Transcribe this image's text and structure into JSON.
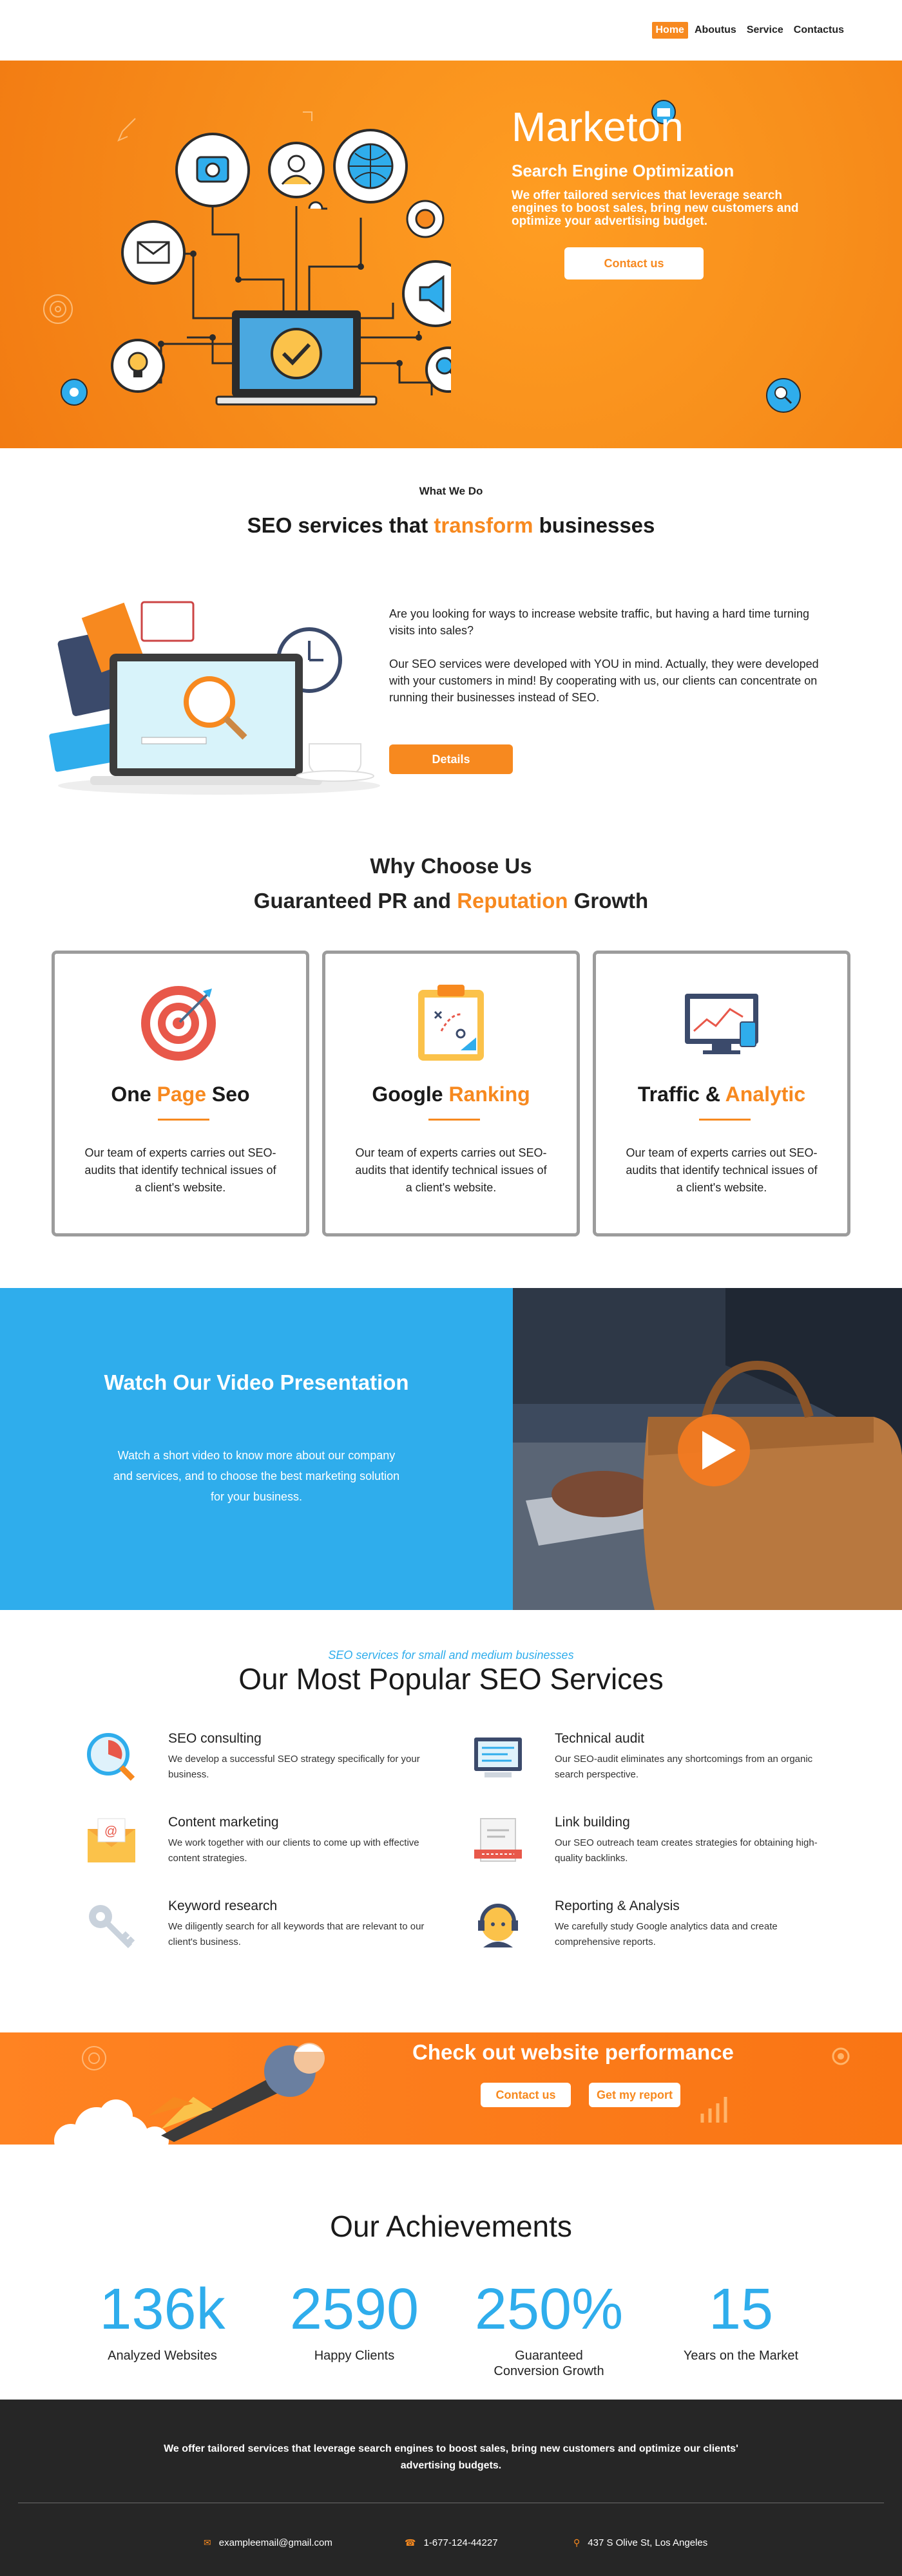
{
  "nav": {
    "items": [
      "Home",
      "Aboutus",
      "Service",
      "Contactus"
    ]
  },
  "hero": {
    "title": "Marketon",
    "subtitle": "Search Engine Optimization",
    "description": "We offer tailored services that leverage search engines to boost sales, bring new customers and optimize your advertising budget.",
    "button": "Contact us"
  },
  "what_we_do": {
    "kicker": "What We Do",
    "heading_pre": "SEO services that ",
    "heading_accent": "transform",
    "heading_post": " businesses",
    "paragraph1": "Are you looking for ways to increase website traffic, but having a hard time turning visits into sales?",
    "paragraph2": "Our SEO services were developed with YOU in mind. Actually, they were developed with your customers in mind! By cooperating with us, our clients can concentrate on running their businesses instead of SEO.",
    "button": "Details"
  },
  "why": {
    "title": "Why Choose Us",
    "heading_pre": "Guaranteed PR and ",
    "heading_accent": "Reputation",
    "heading_post": " Growth",
    "cards": [
      {
        "title_pre": "One ",
        "title_accent": "Page",
        "title_post": " Seo",
        "text": "Our team of experts carries out SEO-audits that identify technical issues of a client's website."
      },
      {
        "title_pre": "Google ",
        "title_accent": "Ranking",
        "title_post": "",
        "text": "Our team of experts carries out SEO-audits that identify technical issues of a client's website."
      },
      {
        "title_pre": "Traffic & ",
        "title_accent": "Analytic",
        "title_post": "",
        "text": "Our team of experts carries out SEO-audits that identify technical issues of a client's website."
      }
    ]
  },
  "video": {
    "title": "Watch Our Video Presentation",
    "description": "Watch a short video to know more about our company and services, and to choose the best marketing solution for your business."
  },
  "services": {
    "kicker": "SEO services for small and medium businesses",
    "heading": "Our Most Popular SEO Services",
    "items": [
      {
        "title": "SEO consulting",
        "desc": "We develop a successful SEO strategy specifically for your business."
      },
      {
        "title": "Technical audit",
        "desc": "Our SEO-audit eliminates any shortcomings from an organic search perspective."
      },
      {
        "title": "Content marketing",
        "desc": "We work together with our clients to come up with effective content strategies."
      },
      {
        "title": "Link building",
        "desc": "Our SEO outreach team creates strategies for obtaining high-quality backlinks."
      },
      {
        "title": "Keyword research",
        "desc": "We diligently search for all keywords that are relevant to our client's business."
      },
      {
        "title": "Reporting & Analysis",
        "desc": "We carefully study Google analytics data and create comprehensive reports."
      }
    ]
  },
  "cta": {
    "title": "Check out website performance",
    "button1": "Contact us",
    "button2": "Get my report"
  },
  "achievements": {
    "heading": "Our Achievements",
    "stats": [
      {
        "value": "136k",
        "label": "Analyzed Websites"
      },
      {
        "value": "2590",
        "label": "Happy Clients"
      },
      {
        "value": "250%",
        "label": "Guaranteed Conversion Growth"
      },
      {
        "value": "15",
        "label": "Years on the Market"
      }
    ]
  },
  "footer": {
    "text": "We offer tailored services that leverage search engines to boost sales, bring new customers and optimize our clients' advertising budgets.",
    "email": "exampleemail@gmail.com",
    "phone": "1-677-124-44227",
    "address": "437 S Olive St, Los Angeles"
  },
  "colors": {
    "accent": "#f7891f",
    "blue": "#2fadec",
    "footer_bg": "#262626"
  }
}
